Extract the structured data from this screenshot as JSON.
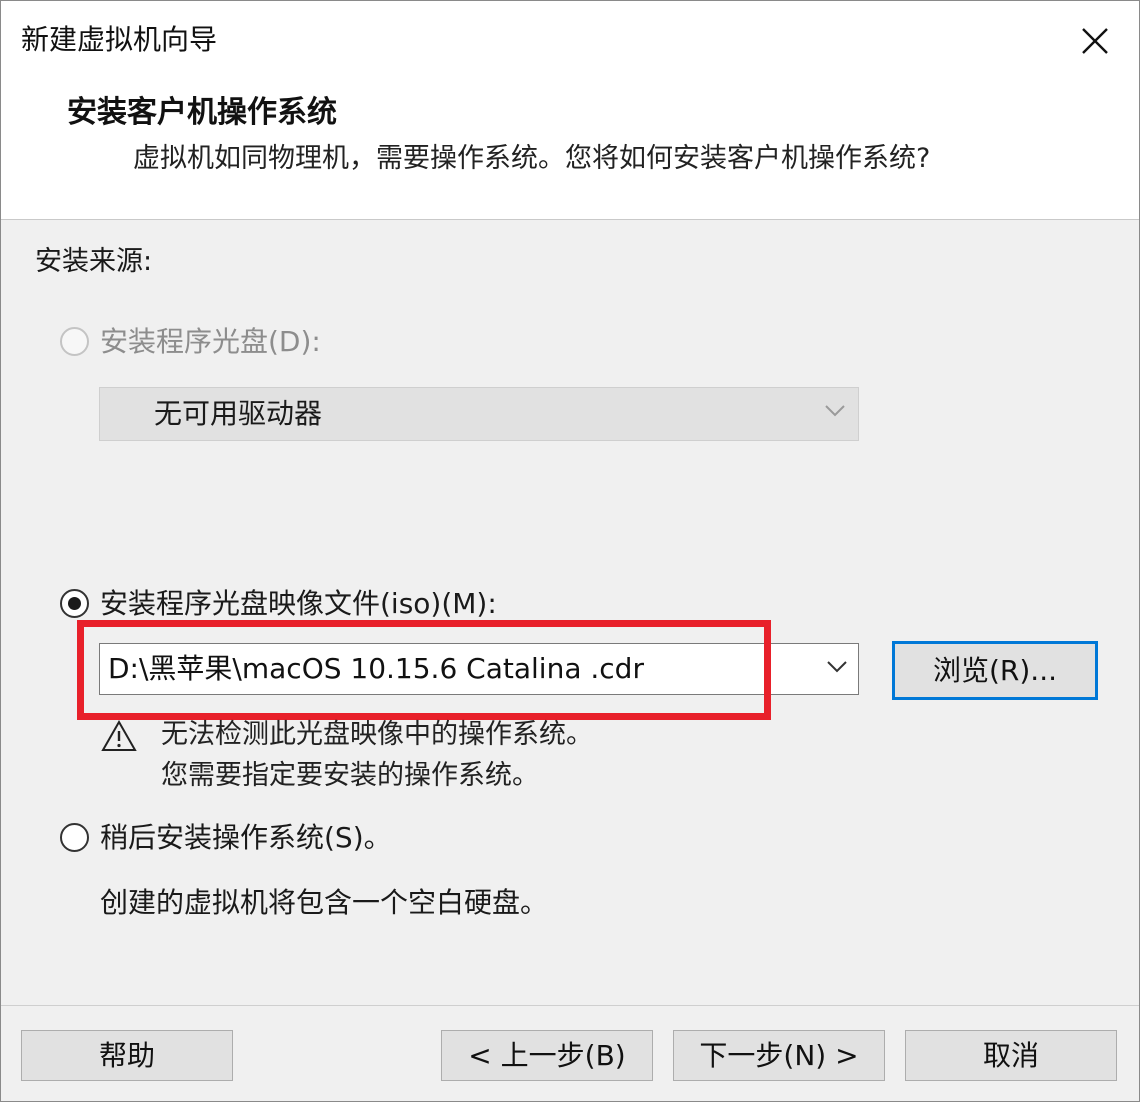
{
  "window": {
    "title": "新建虚拟机向导"
  },
  "header": {
    "heading": "安装客户机操作系统",
    "subheading": "虚拟机如同物理机，需要操作系统。您将如何安装客户机操作系统?"
  },
  "install_source": {
    "label": "安装来源:",
    "options": [
      {
        "label": "安装程序光盘(D):",
        "selected": false,
        "enabled": false,
        "dropdown_value": "无可用驱动器"
      },
      {
        "label": "安装程序光盘映像文件(iso)(M):",
        "selected": true,
        "enabled": true,
        "path_value": "D:\\黑苹果\\macOS 10.15.6 Catalina .cdr",
        "browse_label": "浏览(R)...",
        "warning_line1": "无法检测此光盘映像中的操作系统。",
        "warning_line2": "您需要指定要安装的操作系统。"
      },
      {
        "label": "稍后安装操作系统(S)。",
        "selected": false,
        "enabled": true,
        "description": "创建的虚拟机将包含一个空白硬盘。"
      }
    ]
  },
  "footer": {
    "help_label": "帮助",
    "back_label": "< 上一步(B)",
    "next_label": "下一步(N) >",
    "cancel_label": "取消"
  },
  "colors": {
    "highlight": "#e8202a",
    "focus": "#0078d7"
  }
}
